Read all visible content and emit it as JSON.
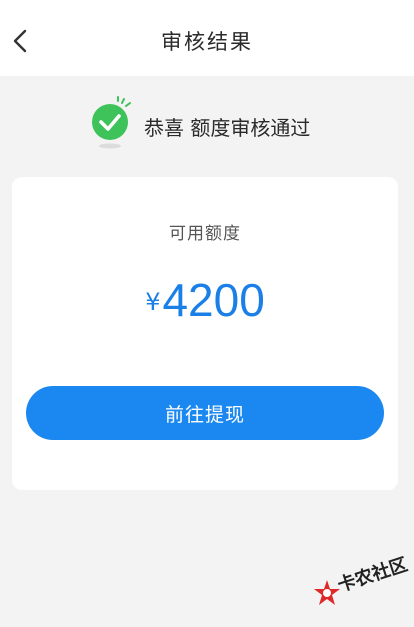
{
  "header": {
    "title": "审核结果",
    "back_icon": "chevron-left-icon"
  },
  "result": {
    "icon": "check-circle-icon",
    "message": "恭喜 额度审核通过"
  },
  "card": {
    "amount_label": "可用额度",
    "currency_symbol": "¥",
    "amount": "4200",
    "button_label": "前往提现"
  },
  "watermark": {
    "text": "卡农社区"
  },
  "colors": {
    "accent": "#1a88f0",
    "amount": "#1a7fe6",
    "success": "#3ec35a",
    "background": "#f3f3f3"
  }
}
